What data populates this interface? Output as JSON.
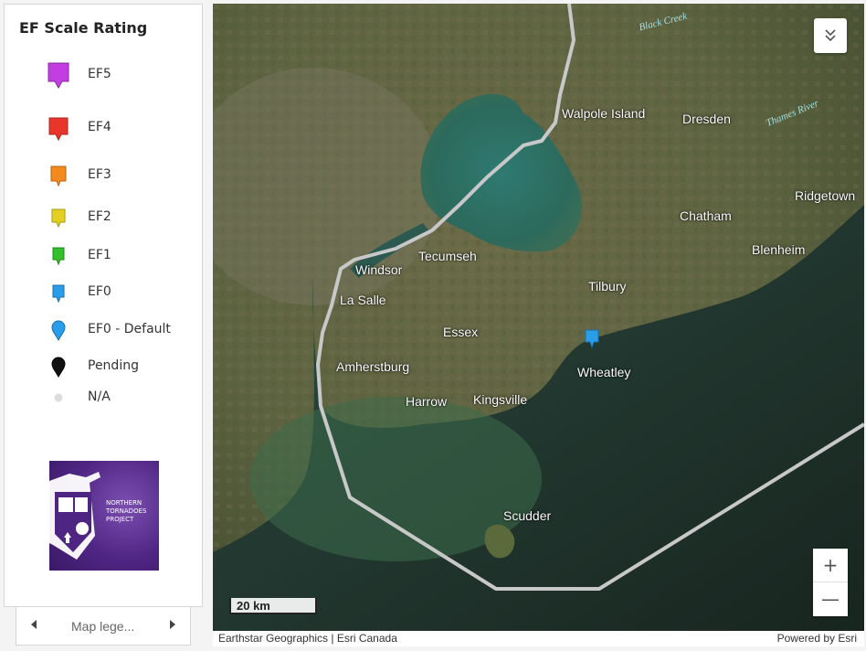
{
  "legend": {
    "title": "EF Scale Rating",
    "items": [
      {
        "label": "EF5",
        "color": "#c23ee0",
        "symbol": "square-pin",
        "icon": "ef5-marker-icon"
      },
      {
        "label": "EF4",
        "color": "#e8362a",
        "symbol": "square-pin",
        "icon": "ef4-marker-icon"
      },
      {
        "label": "EF3",
        "color": "#f28a1d",
        "symbol": "square-pin",
        "icon": "ef3-marker-icon"
      },
      {
        "label": "EF2",
        "color": "#e4d020",
        "symbol": "square-pin",
        "icon": "ef2-marker-icon"
      },
      {
        "label": "EF1",
        "color": "#33c02a",
        "symbol": "square-pin",
        "icon": "ef1-marker-icon"
      },
      {
        "label": "EF0",
        "color": "#2a9de8",
        "symbol": "square-pin",
        "icon": "ef0-marker-icon"
      },
      {
        "label": "EF0 - Default",
        "color": "#2a9de8",
        "symbol": "round-pin",
        "icon": "ef0-default-marker-icon"
      },
      {
        "label": "Pending",
        "color": "#111111",
        "symbol": "round-pin",
        "icon": "pending-marker-icon"
      },
      {
        "label": "N/A",
        "color": "#dddddd",
        "symbol": "dot",
        "icon": "na-dot-icon"
      }
    ],
    "logo": {
      "lines": [
        "NORTHERN",
        "TORNADOES",
        "PROJECT"
      ],
      "color": "#4f2583"
    }
  },
  "footer": {
    "label": "Map lege...",
    "prev_icon": "chevron-left-icon",
    "next_icon": "chevron-right-icon"
  },
  "map": {
    "places": [
      {
        "name": "Walpole Island",
        "key": "walpole-island"
      },
      {
        "name": "Dresden",
        "key": "dresden"
      },
      {
        "name": "Ridgetown",
        "key": "ridgetown"
      },
      {
        "name": "Chatham",
        "key": "chatham"
      },
      {
        "name": "Blenheim",
        "key": "blenheim"
      },
      {
        "name": "Tecumseh",
        "key": "tecumseh"
      },
      {
        "name": "Windsor",
        "key": "windsor"
      },
      {
        "name": "La Salle",
        "key": "la-salle"
      },
      {
        "name": "Tilbury",
        "key": "tilbury"
      },
      {
        "name": "Essex",
        "key": "essex"
      },
      {
        "name": "Amherstburg",
        "key": "amherstburg"
      },
      {
        "name": "Wheatley",
        "key": "wheatley"
      },
      {
        "name": "Harrow",
        "key": "harrow"
      },
      {
        "name": "Kingsville",
        "key": "kingsville"
      },
      {
        "name": "Scudder",
        "key": "scudder"
      }
    ],
    "water_labels": [
      "Black Creek",
      "Thames River"
    ],
    "marker": {
      "rating": "EF0",
      "color": "#2a9de8"
    },
    "scale_text": "20 km",
    "zoom_in_label": "+",
    "zoom_out_label": "—",
    "collapse_icon": "double-chevron-down-icon",
    "attribution_left": "Earthstar Geographics | Esri Canada",
    "attribution_right": "Powered by Esri"
  }
}
